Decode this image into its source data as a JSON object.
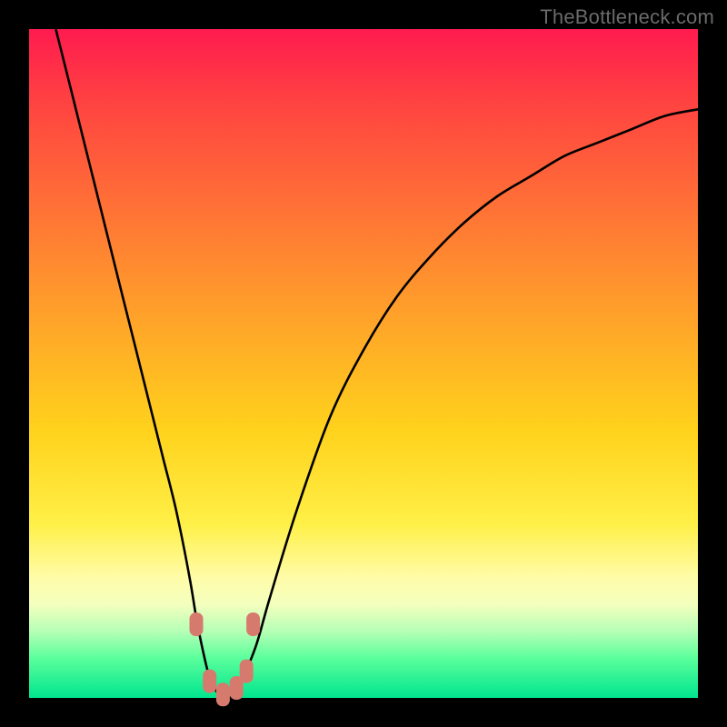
{
  "watermark": "TheBottleneck.com",
  "colors": {
    "frame_bg": "#000000",
    "curve_stroke": "#000000",
    "marker_fill": "#d77a6e"
  },
  "chart_data": {
    "type": "line",
    "title": "",
    "xlabel": "",
    "ylabel": "",
    "xlim": [
      0,
      100
    ],
    "ylim": [
      0,
      100
    ],
    "grid": false,
    "legend": false,
    "annotations": [],
    "series": [
      {
        "name": "bottleneck-curve",
        "x": [
          4,
          6,
          8,
          10,
          12,
          14,
          16,
          18,
          20,
          22,
          24,
          25,
          26,
          27,
          28,
          29,
          30,
          31,
          32,
          34,
          36,
          40,
          45,
          50,
          55,
          60,
          65,
          70,
          75,
          80,
          85,
          90,
          95,
          100
        ],
        "y": [
          100,
          92,
          84,
          76,
          68,
          60,
          52,
          44,
          36,
          28,
          18,
          12,
          7,
          3,
          1,
          0,
          0,
          1,
          3,
          8,
          15,
          28,
          42,
          52,
          60,
          66,
          71,
          75,
          78,
          81,
          83,
          85,
          87,
          88
        ]
      }
    ],
    "markers": [
      {
        "x": 25.0,
        "y": 11
      },
      {
        "x": 27.0,
        "y": 2.5
      },
      {
        "x": 29.0,
        "y": 0.5
      },
      {
        "x": 31.0,
        "y": 1.5
      },
      {
        "x": 32.5,
        "y": 4
      },
      {
        "x": 33.5,
        "y": 11
      }
    ]
  }
}
